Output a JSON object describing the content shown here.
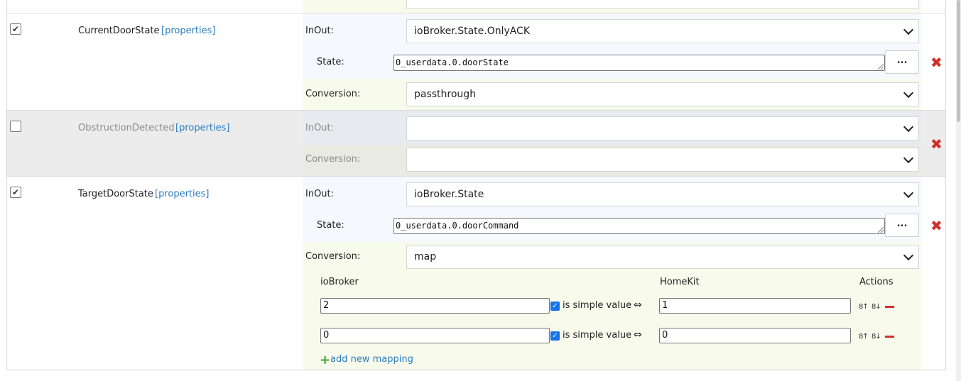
{
  "rows": [
    {
      "checked": "✔",
      "name": "CurrentDoorState",
      "props": "[properties]",
      "inout_label": "InOut:",
      "inout_value": "ioBroker.State.OnlyACK",
      "state_label": "State:",
      "state_value": "0_userdata.0.doorState",
      "conversion_label": "Conversion:",
      "conversion_value": "passthrough"
    },
    {
      "checked": "",
      "name": "ObstructionDetected",
      "props": "[properties]",
      "inout_label": "InOut:",
      "inout_value": "",
      "conversion_label": "Conversion:",
      "conversion_value": ""
    },
    {
      "checked": "✔",
      "name": "TargetDoorState",
      "props": "[properties]",
      "inout_label": "InOut:",
      "inout_value": "ioBroker.State",
      "state_label": "State:",
      "state_value": "0_userdata.0.doorCommand",
      "conversion_label": "Conversion:",
      "conversion_value": "map"
    }
  ],
  "dots_label": "...",
  "delete_glyph": "✖",
  "mapping": {
    "head_iobroker": "ioBroker",
    "head_homekit": "HomeKit",
    "head_actions": "Actions",
    "simple_label": "is simple value",
    "arrow": "⇔",
    "check": "✓",
    "sort_up": "8↑",
    "sort_down": "8↓",
    "entries": [
      {
        "iobroker": "2",
        "homekit": "1"
      },
      {
        "iobroker": "0",
        "homekit": "0"
      }
    ],
    "add_label": "add new mapping",
    "add_glyph": "+"
  },
  "colors": {
    "link": "#2a7cc0",
    "delete": "#d0312d",
    "add": "#3aa832",
    "checkbox_blue": "#1a73e8",
    "inout_bg": "#f5f9fe",
    "conversion_bg": "#f8faeb"
  }
}
